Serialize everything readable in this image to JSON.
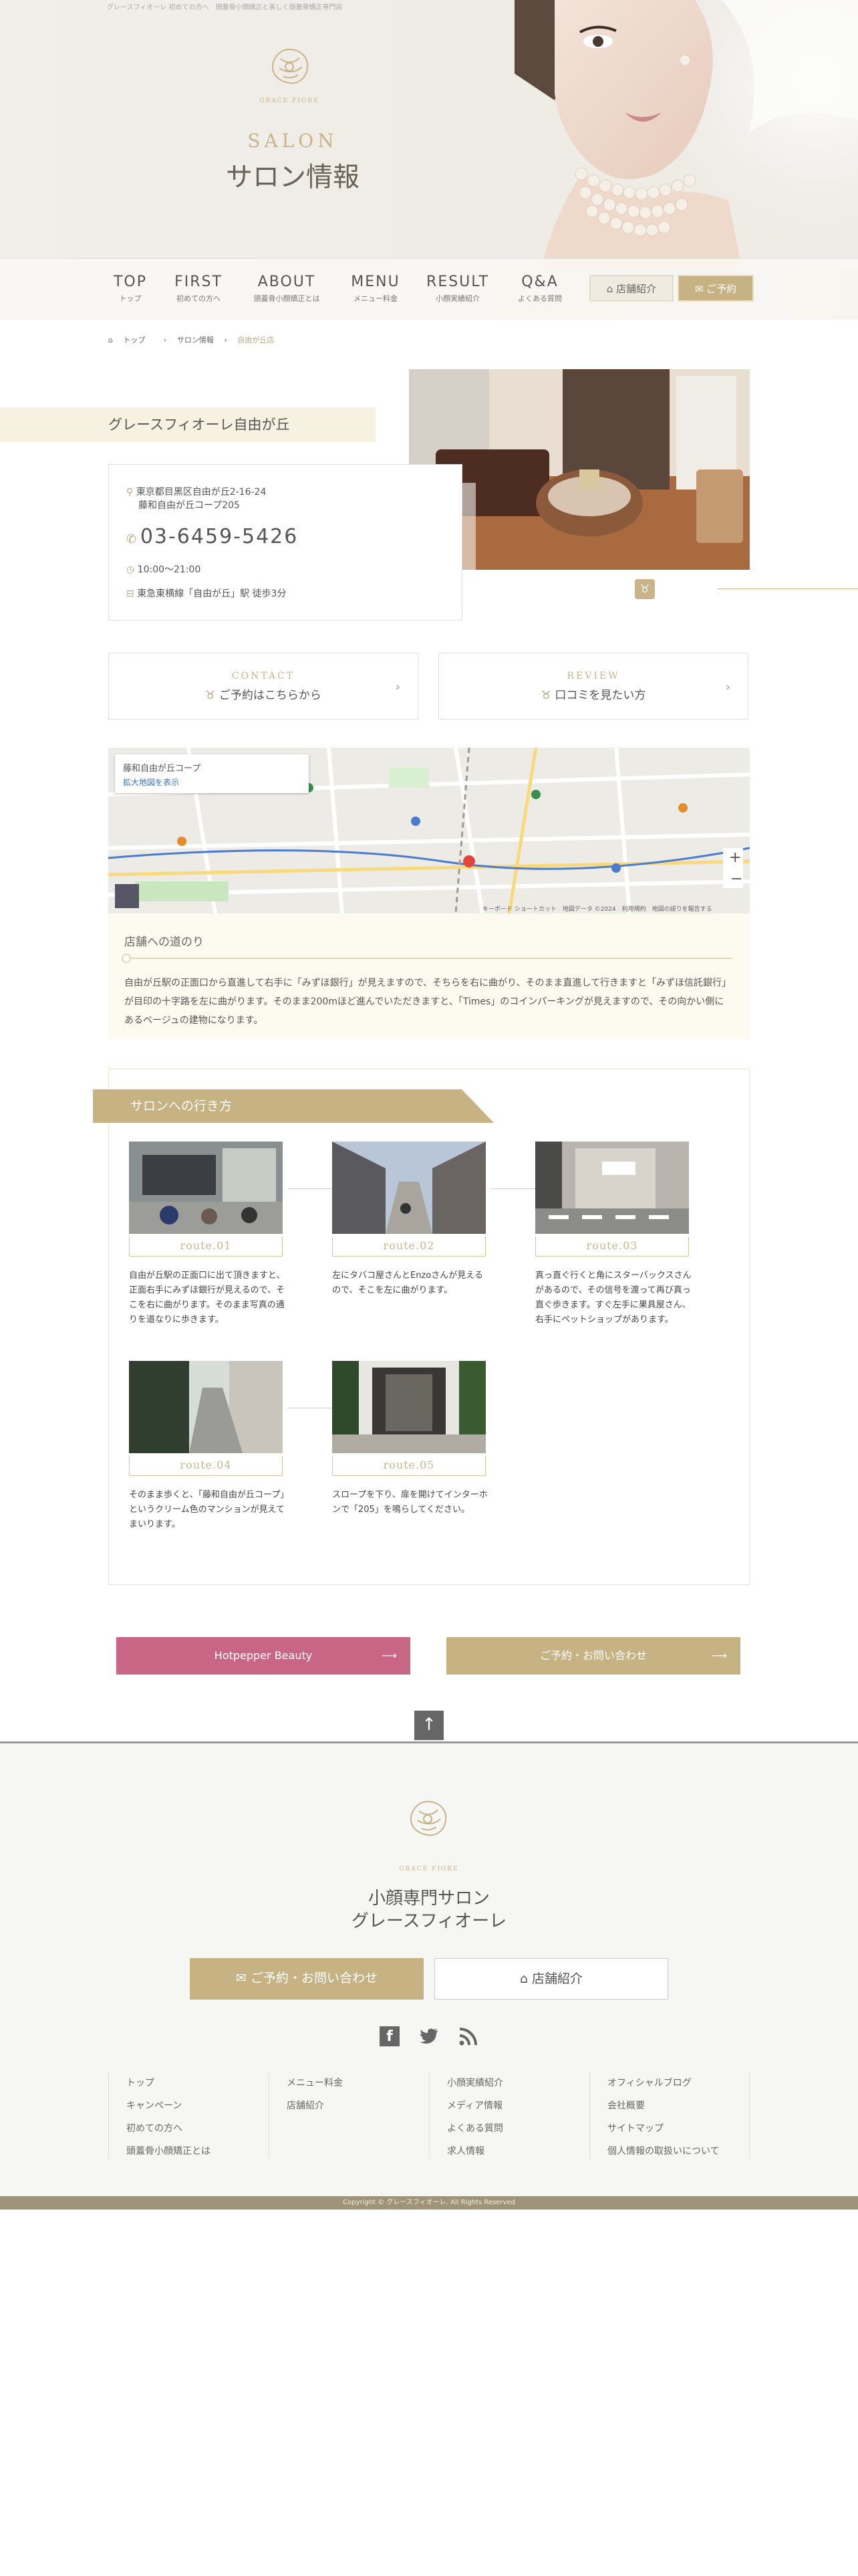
{
  "tagline": "グレースフィオーレ 初めての方へ　頭蓋骨小顔矯正と美しく頭蓋骨矯正専門店",
  "brand": {
    "logo_text": "GRACE FIORE"
  },
  "hero": {
    "title_en": "SALON",
    "title_ja": "サロン情報"
  },
  "nav": {
    "items": [
      {
        "en": "TOP",
        "ja": "トップ"
      },
      {
        "en": "FIRST",
        "ja": "初めての方へ"
      },
      {
        "en": "ABOUT",
        "ja": "頭蓋骨小顔矯正とは"
      },
      {
        "en": "MENU",
        "ja": "メニュー料金"
      },
      {
        "en": "RESULT",
        "ja": "小顔実績紹介"
      },
      {
        "en": "Q&A",
        "ja": "よくある質問"
      }
    ],
    "shop_btn": "店舗紹介",
    "reserve_btn": "ご予約"
  },
  "breadcrumb": [
    "トップ",
    "サロン情報",
    "自由が丘店"
  ],
  "shop": {
    "name": "グレースフィオーレ自由が丘",
    "address1": "東京都目黒区自由が丘2-16-24",
    "address2": "藤和自由が丘コープ205",
    "tel": "03-6459-5426",
    "hours": "10:00〜21:00",
    "access": "東急東横線「自由が丘」駅 徒歩3分"
  },
  "cta": {
    "contact_en": "CONTACT",
    "contact_ja": "ご予約はこちらから",
    "review_en": "REVIEW",
    "review_ja": "口コミを見たい方"
  },
  "map": {
    "place": "藤和自由が丘コープ",
    "link": "拡大地図を表示",
    "footer": "キーボード ショートカット　地図データ ©2024　利用規約　地図の誤りを報告する"
  },
  "road": {
    "title": "店舗への道のり",
    "text": "自由が丘駅の正面口から直進して右手に「みずほ銀行」が見えますので、そちらを右に曲がり、そのまま直進して行きますと「みずほ信託銀行」が目印の十字路を左に曲がります。そのまま200mほど進んでいただきますと、「Times」のコインパーキングが見えますので、その向かい側にあるベージュの建物になります。"
  },
  "route": {
    "heading": "サロンへの行き方",
    "steps": [
      {
        "label": "route.01",
        "text": "自由が丘駅の正面口に出て頂きますと、正面右手にみずほ銀行が見えるので、そこを右に曲がります。そのまま写真の通りを道なりに歩きます。"
      },
      {
        "label": "route.02",
        "text": "左にタバコ屋さんとEnzoさんが見えるので、そこを左に曲がります。"
      },
      {
        "label": "route.03",
        "text": "真っ直ぐ行くと角にスターバックスさんがあるので、その信号を渡って再び真っ直ぐ歩きます。すぐ左手に果具屋さん、右手にペットショップがあります。"
      },
      {
        "label": "route.04",
        "text": "そのまま歩くと、「藤和自由が丘コープ」というクリーム色のマンションが見えてまいります。"
      },
      {
        "label": "route.05",
        "text": "スロープを下り、扉を開けてインターホンで「205」を鳴らしてください。"
      }
    ]
  },
  "buttons": {
    "hotpepper": "Hotpepper Beauty",
    "contact": "ご予約・お問い合わせ"
  },
  "footer": {
    "title1": "小顔専門サロン",
    "title2": "グレースフィオーレ",
    "contact_btn": "ご予約・お問い合わせ",
    "shop_btn": "店舗紹介",
    "cols": [
      [
        "トップ",
        "キャンペーン",
        "初めての方へ",
        "頭蓋骨小顔矯正とは"
      ],
      [
        "メニュー料金",
        "店舗紹介"
      ],
      [
        "小顔実績紹介",
        "メディア情報",
        "よくある質問",
        "求人情報"
      ],
      [
        "オフィシャルブログ",
        "会社概要",
        "サイトマップ",
        "個人情報の取扱いについて"
      ]
    ],
    "copyright": "Copyright © グレースフィオーレ. All Rights Reserved"
  },
  "colors": {
    "gold": "#c6b283",
    "pink": "#c96585",
    "cream": "#f7f1e2"
  }
}
